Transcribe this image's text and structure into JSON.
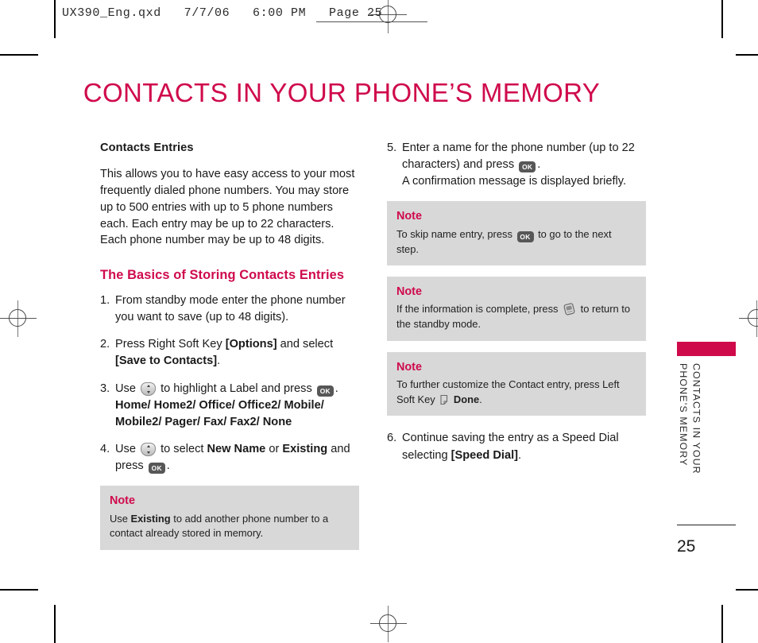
{
  "file_header": {
    "text": "UX390_Eng.qxd   7/7/06   6:00 PM   Page 25"
  },
  "page_title": "CONTACTS IN YOUR PHONE’S MEMORY",
  "left_column": {
    "section_heading": "Contacts Entries",
    "intro_paragraph": "This allows you to have easy access to your most frequently dialed phone numbers. You may store up to 500 entries with up to 5 phone numbers each. Each entry may be up to 22 characters. Each phone number may be up to 48 digits.",
    "sub_heading": "The Basics of Storing Contacts Entries",
    "steps": [
      {
        "num": "1.",
        "text": "From standby mode enter the phone number you want to save (up to 48 digits)."
      },
      {
        "num": "2.",
        "lead": "Press Right Soft Key ",
        "bold1": "[Options]",
        "mid": " and select ",
        "bold2": "[Save to Contacts]",
        "tail": "."
      },
      {
        "num": "3.",
        "lead": "Use ",
        "mid": " to highlight a Label and press ",
        "tail": ".",
        "labels": "Home/ Home2/ Office/ Office2/ Mobile/ Mobile2/ Pager/ Fax/ Fax2/ None"
      },
      {
        "num": "4.",
        "lead": "Use ",
        "mid": " to select ",
        "bold1": "New Name",
        "mid2": " or ",
        "bold2": "Existing",
        "mid3": " and press ",
        "tail": "."
      }
    ],
    "note": {
      "title": "Note",
      "lead": "Use ",
      "bold": "Existing",
      "tail": " to add another phone number to a contact already stored in memory."
    }
  },
  "right_column": {
    "step5": {
      "num": "5.",
      "lead": "Enter a name for the phone number (up to 22 characters) and press ",
      "tail": ".",
      "line2": "A confirmation message is displayed briefly."
    },
    "notes": [
      {
        "title": "Note",
        "lead": "To skip name entry, press ",
        "tail": " to go to the next step."
      },
      {
        "title": "Note",
        "lead": "If the information is complete, press ",
        "tail": " to return to the standby mode."
      },
      {
        "title": "Note",
        "lead": "To further customize the Contact entry, press Left Soft Key ",
        "bold": "Done",
        "tail": "."
      }
    ],
    "step6": {
      "num": "6.",
      "lead": "Continue saving the entry as a Speed Dial selecting ",
      "bold": "[Speed Dial]",
      "tail": "."
    }
  },
  "side_tab": {
    "line1": "CONTACTS IN YOUR",
    "line2": "PHONE’S MEMORY"
  },
  "page_number": "25",
  "icons": {
    "ok_label": "OK",
    "nav_key": "navigation-key-icon",
    "end_key": "end-key-icon",
    "soft_key": "soft-key-icon"
  },
  "colors": {
    "accent": "#cf0a4b",
    "note_bg": "#d8d8d8",
    "text": "#1a1a1a"
  }
}
